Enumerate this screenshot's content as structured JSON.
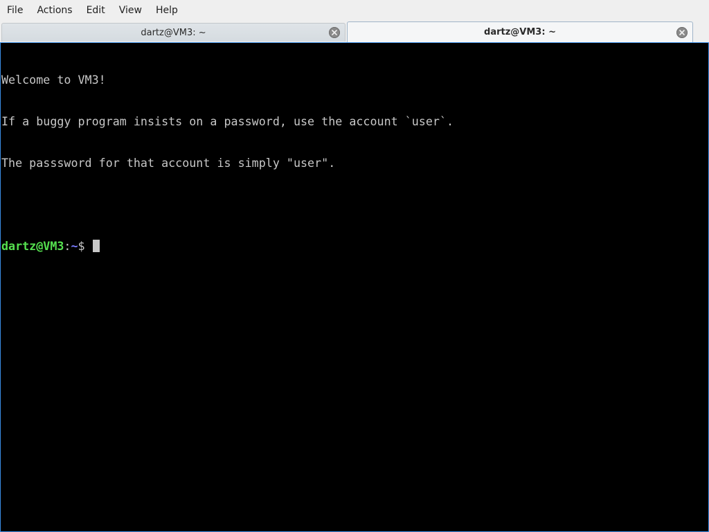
{
  "menubar": {
    "items": [
      {
        "label": "File"
      },
      {
        "label": "Actions"
      },
      {
        "label": "Edit"
      },
      {
        "label": "View"
      },
      {
        "label": "Help"
      }
    ]
  },
  "tabs": [
    {
      "label": "dartz@VM3: ~",
      "active": false
    },
    {
      "label": "dartz@VM3: ~",
      "active": true
    }
  ],
  "terminal": {
    "lines": [
      "Welcome to VM3!",
      "If a buggy program insists on a password, use the account `user`.",
      "The passsword for that account is simply \"user\".",
      ""
    ],
    "prompt": {
      "user_host": "dartz@VM3",
      "colon": ":",
      "path": "~",
      "dollar": "$ "
    }
  },
  "colors": {
    "prompt_user": "#55e04f",
    "prompt_path": "#7a7cff",
    "terminal_bg": "#000000",
    "terminal_fg": "#c8c8c8",
    "focus_border": "#3a8ee6"
  },
  "icons": {
    "tab_close": "close-circle-icon"
  }
}
